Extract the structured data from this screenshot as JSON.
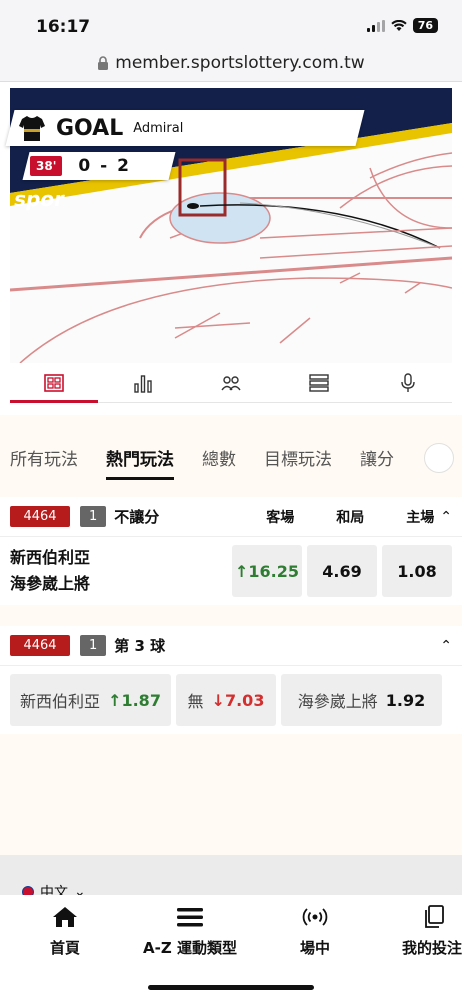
{
  "status_bar": {
    "time": "16:17",
    "battery": "76"
  },
  "browser": {
    "url": "member.sportslottery.com.tw"
  },
  "event": {
    "headline": "GOAL",
    "team": "Admiral",
    "minute": "38'",
    "score": "0 - 2"
  },
  "match_tabs": [
    "scoreboard-icon",
    "stats-icon",
    "lineups-icon",
    "list-icon",
    "mic-icon"
  ],
  "bet_tabs": [
    "所有玩法",
    "熱門玩法",
    "總數",
    "目標玩法",
    "讓分"
  ],
  "markets": [
    {
      "id": "4464",
      "num": "1",
      "title": "不讓分",
      "columns": [
        "客場",
        "和局",
        "主場"
      ],
      "home_team": "新西伯利亞",
      "away_team": "海參崴上將",
      "odds": [
        {
          "value": "16.25",
          "trend": "up"
        },
        {
          "value": "4.69",
          "trend": ""
        },
        {
          "value": "1.08",
          "trend": ""
        }
      ]
    },
    {
      "id": "4464",
      "num": "1",
      "title": "第 3 球",
      "options": [
        {
          "label": "新西伯利亞",
          "value": "1.87",
          "trend": "up"
        },
        {
          "label": "無",
          "value": "7.03",
          "trend": "down"
        },
        {
          "label": "海參崴上將",
          "value": "1.92",
          "trend": ""
        }
      ]
    }
  ],
  "language": "中文",
  "nav": [
    {
      "icon": "home-icon",
      "label": "首頁"
    },
    {
      "icon": "menu-icon",
      "label": "A-Z 運動類型"
    },
    {
      "icon": "live-icon",
      "label": "場中"
    },
    {
      "icon": "my-bets-icon",
      "label": "我的投注"
    }
  ],
  "colors": {
    "accent": "#c8102e",
    "up": "#2e7d32",
    "down": "#d32f2f"
  }
}
